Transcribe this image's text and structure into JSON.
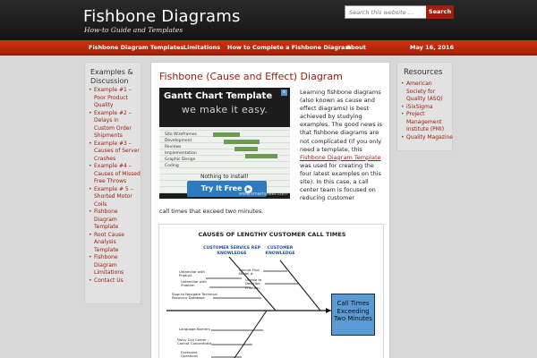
{
  "header": {
    "site_title": "Fishbone Diagrams",
    "tagline": "How-to Guide and Templates",
    "search_placeholder": "Search this website …",
    "search_button": "Search"
  },
  "nav": {
    "items": [
      "Fishbone Diagram Templates",
      "Limitations",
      "How to Complete a Fishbone Diagram",
      "About"
    ],
    "date": "May 16, 2016"
  },
  "left_sidebar": {
    "heading": "Examples & Discussion",
    "items": [
      "Example #1 – Poor Product Quality",
      "Example #2 – Delays in Custom Order Shipments",
      "Example #3 – Causes of Server Crashes",
      "Example #4 – Causes of Missed Free Throws",
      "Example # 5 – Shorted Motor Coils",
      "Fishbone Diagram Template",
      "Root Cause Analysis Template",
      "Fishbone Diagram Limitations",
      "Contact Us"
    ]
  },
  "main": {
    "title": "Fishbone (Cause and Effect) Diagram",
    "ad": {
      "title": "Gantt Chart Template",
      "subtitle": "we make it easy.",
      "nothing_to_install": "Nothing to install!",
      "cta": "Try It Free",
      "url": "www.smartsheet.com",
      "close": "x",
      "rows": [
        "Site Wireframes",
        "Development",
        "Reviews",
        "Implementation",
        "Graphic Design",
        "Coding"
      ]
    },
    "intro_text": "Learning fishbone diagrams (also known as cause and effect diagrams) is best achieved by studying examples.  The good news is that fishbone diagrams are not complicated (if you only need a template, this",
    "intro_link": "Fishbone Diagram Template",
    "intro_text_after": "was used for creating the four latest examples on this site).  In this case, a call center team is focused on reducing customer",
    "intro_tail": "call times that exceed two minutes.",
    "figure": {
      "title": "CAUSES OF LENGTHY CUSTOMER CALL TIMES",
      "category_1": "CUSTOMER SERVICE REP KNOWLEDGE",
      "category_2": "CUSTOMER KNOWLEDGE",
      "causes_upper_left": [
        "Unfamiliar with Product",
        "Unfamiliar with Problem",
        "Slow to Navigate Technical Resource Database"
      ],
      "causes_upper_right": [
        "Cannot Find Model #",
        "Unable to Describe Problem"
      ],
      "causes_lower": [
        "Language Barriers",
        "Noisy Call Center – Cannot Concentrate",
        "Excessive Questions"
      ],
      "effect": "Call Times Exceeding Two Minutes"
    }
  },
  "right_sidebar": {
    "heading": "Resources",
    "items": [
      "American Society for Quality (ASQ)",
      "iSixSigma",
      "Project Management Institute (PMI)",
      "Quality Magazine"
    ]
  },
  "colors": {
    "accent": "#a01e0c",
    "nav_red": "#c62b0d",
    "header_dark": "#1c1c1c",
    "effect_box": "#5b9bd5",
    "category_blue": "#1a4f9b"
  }
}
